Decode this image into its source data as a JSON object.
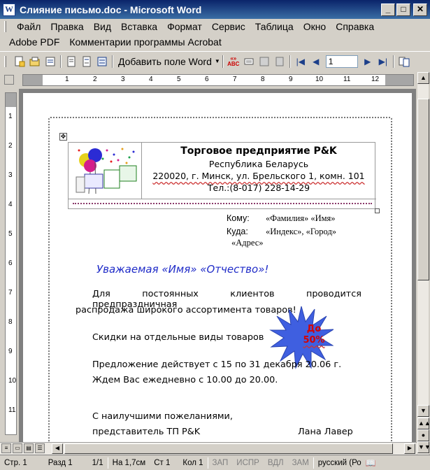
{
  "window": {
    "title": "Слияние письмо.doc - Microsoft Word"
  },
  "menu": [
    "Файл",
    "Правка",
    "Вид",
    "Вставка",
    "Формат",
    "Сервис",
    "Таблица",
    "Окно",
    "Справка"
  ],
  "menu2": [
    "Adobe PDF",
    "Комментарии программы Acrobat"
  ],
  "toolbar": {
    "add_field": "Добавить поле Word",
    "record_number": "1"
  },
  "ruler": [
    "1",
    "2",
    "3",
    "4",
    "5",
    "6",
    "7",
    "8",
    "9",
    "10",
    "11",
    "12"
  ],
  "vruler": [
    "1",
    "2",
    "3",
    "4",
    "5",
    "6",
    "7",
    "8",
    "9",
    "10",
    "11"
  ],
  "letterhead": {
    "company": "Торговое предприятие P&K",
    "country": "Республика Беларусь",
    "address": "220020, г. Минск, ул. Брельского 1, комн. 101",
    "phone": "Тел.:(8-017) 228-14-29"
  },
  "recipient": {
    "to_label": "Кому:",
    "to_value": "«Фамилия» «Имя»",
    "where_label": "Куда:",
    "where_value": "«Индекс», «Город»",
    "where_value2": "«Адрес»"
  },
  "letter": {
    "greeting": "Уважаемая «Имя» «Отчество»!",
    "para1_line1": "Для постоянных клиентов проводится предпраздничная",
    "para1_line2": "распродажа широкого ассортимента товаров!",
    "discount": "Скидки на отдельные виды товаров",
    "offer_line1": "Предложение действует с 15 по 31 декабря 20.06 г.",
    "offer_line2": "Ждем Вас ежедневно с 10.00 до 20.00.",
    "closing": "С наилучшими пожеланиями,",
    "signature_title": "представитель ТП P&K",
    "signature_name": "Лана Лавер",
    "badge_line1": "До",
    "badge_line2": "50%"
  },
  "status": {
    "page": "Стр. 1",
    "section": "Разд 1",
    "pages": "1/1",
    "position": "На 1,7см",
    "line": "Ст 1",
    "column": "Кол 1",
    "rec": "ЗАП",
    "trk": "ИСПР",
    "ext": "ВДЛ",
    "ovr": "ЗАМ",
    "language": "русский (Ро"
  },
  "colors": {
    "title_bar": "#0a246a",
    "greeting": "#1f2bc8",
    "badge_fill": "#3f5fe0",
    "badge_text": "#d40000"
  }
}
